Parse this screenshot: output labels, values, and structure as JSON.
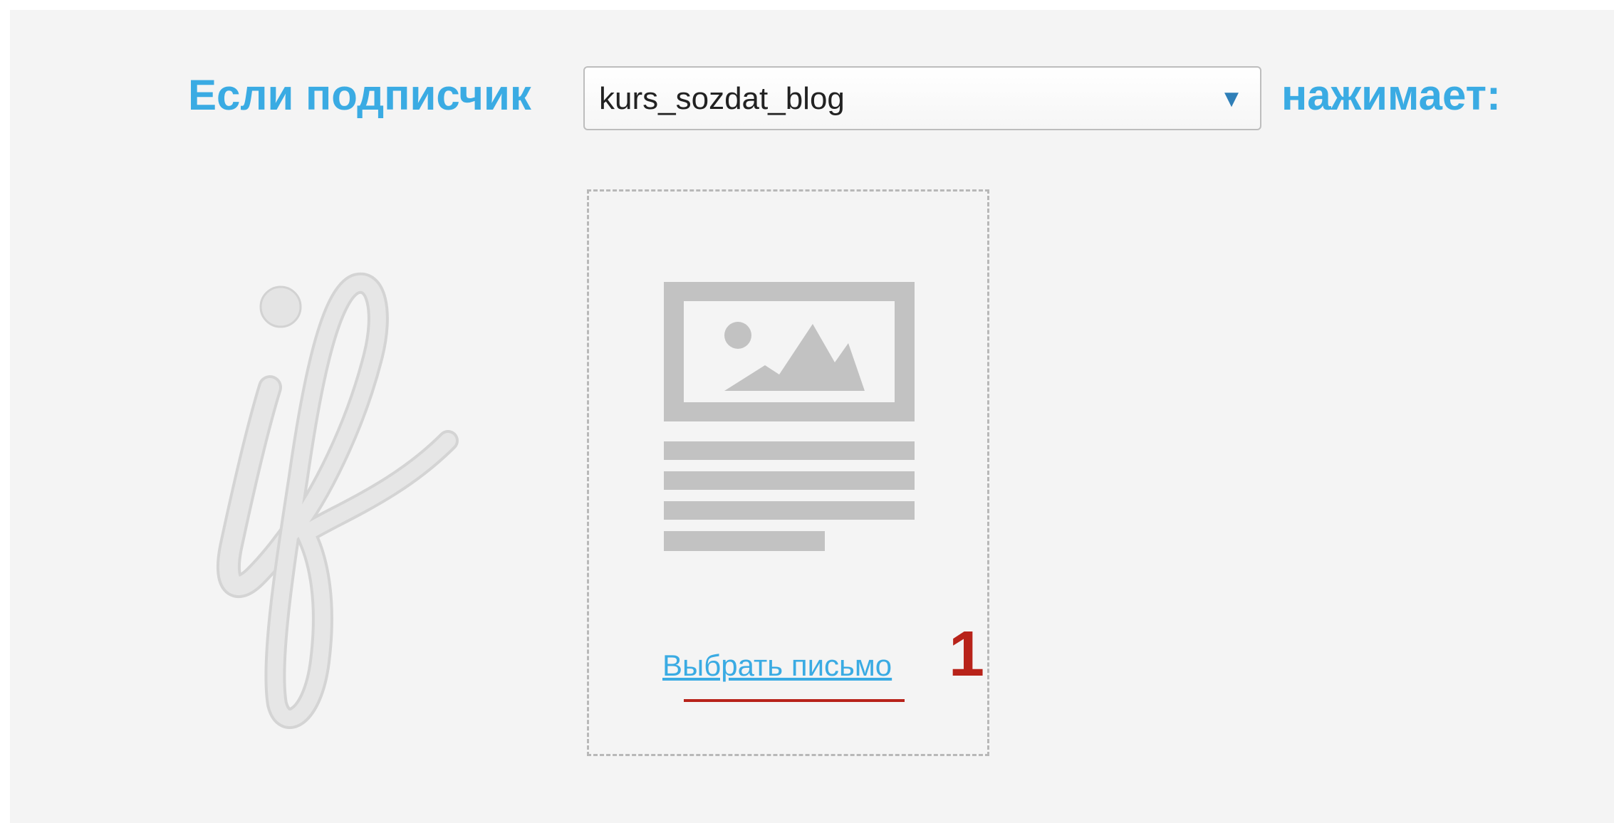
{
  "header": {
    "condition_prefix": "Если подписчик",
    "condition_suffix": "нажимает:"
  },
  "letter_select": {
    "selected_value": "kurs_sozdat_blog",
    "arrow_glyph": "▼"
  },
  "email_slot": {
    "icon": "email-placeholder-icon",
    "choose_link_label": "Выбрать письмо",
    "annotation_number": "1"
  },
  "decor": {
    "if_glyph_icon": "script-if-icon"
  },
  "colors": {
    "accent_blue": "#3aabe3",
    "annotation_red": "#b8231a",
    "background": "#f4f4f4",
    "placeholder_gray": "#c2c2c2"
  }
}
